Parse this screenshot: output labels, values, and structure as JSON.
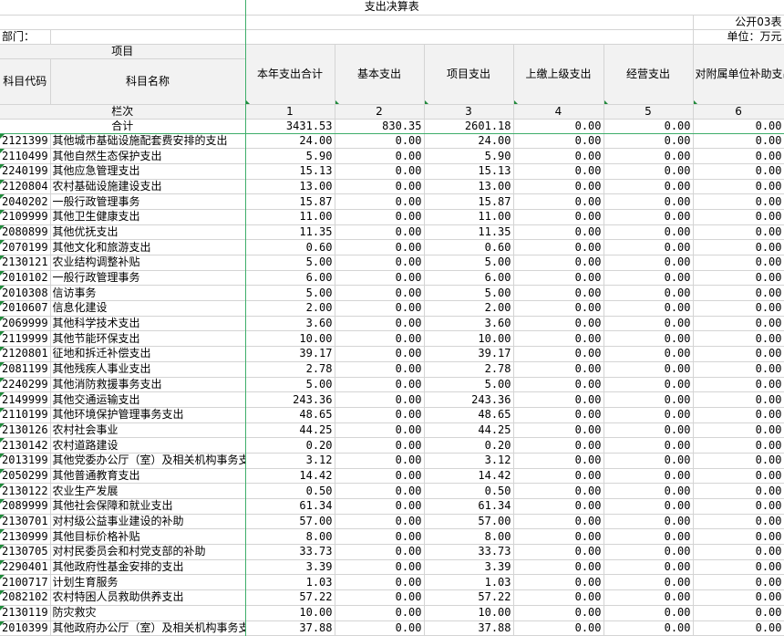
{
  "title": "支出决算表",
  "table_no": "公开03表",
  "department_label": "部门：",
  "unit_label": "单位：万元",
  "header": {
    "item_group": "项目",
    "code": "科目代码",
    "name": "科目名称",
    "cols": [
      "本年支出合计",
      "基本支出",
      "项目支出",
      "上缴上级支出",
      "经营支出",
      "对附属单位补助支出"
    ],
    "order_label": "栏次",
    "order_nums": [
      "1",
      "2",
      "3",
      "4",
      "5",
      "6"
    ]
  },
  "total": {
    "label": "合计",
    "values": [
      "3431.53",
      "830.35",
      "2601.18",
      "0.00",
      "0.00",
      "0.00"
    ]
  },
  "rows": [
    {
      "code": "2121399",
      "name": "其他城市基础设施配套费安排的支出",
      "v": [
        "24.00",
        "0.00",
        "24.00",
        "0.00",
        "0.00",
        "0.00"
      ]
    },
    {
      "code": "2110499",
      "name": "其他自然生态保护支出",
      "v": [
        "5.90",
        "0.00",
        "5.90",
        "0.00",
        "0.00",
        "0.00"
      ]
    },
    {
      "code": "2240199",
      "name": "其他应急管理支出",
      "v": [
        "15.13",
        "0.00",
        "15.13",
        "0.00",
        "0.00",
        "0.00"
      ]
    },
    {
      "code": "2120804",
      "name": "农村基础设施建设支出",
      "v": [
        "13.00",
        "0.00",
        "13.00",
        "0.00",
        "0.00",
        "0.00"
      ]
    },
    {
      "code": "2040202",
      "name": "一般行政管理事务",
      "v": [
        "15.87",
        "0.00",
        "15.87",
        "0.00",
        "0.00",
        "0.00"
      ]
    },
    {
      "code": "2109999",
      "name": "其他卫生健康支出",
      "v": [
        "11.00",
        "0.00",
        "11.00",
        "0.00",
        "0.00",
        "0.00"
      ]
    },
    {
      "code": "2080899",
      "name": "其他优抚支出",
      "v": [
        "11.35",
        "0.00",
        "11.35",
        "0.00",
        "0.00",
        "0.00"
      ]
    },
    {
      "code": "2070199",
      "name": "其他文化和旅游支出",
      "v": [
        "0.60",
        "0.00",
        "0.60",
        "0.00",
        "0.00",
        "0.00"
      ]
    },
    {
      "code": "2130121",
      "name": "农业结构调整补贴",
      "v": [
        "5.00",
        "0.00",
        "5.00",
        "0.00",
        "0.00",
        "0.00"
      ]
    },
    {
      "code": "2010102",
      "name": "一般行政管理事务",
      "v": [
        "6.00",
        "0.00",
        "6.00",
        "0.00",
        "0.00",
        "0.00"
      ]
    },
    {
      "code": "2010308",
      "name": "信访事务",
      "v": [
        "5.00",
        "0.00",
        "5.00",
        "0.00",
        "0.00",
        "0.00"
      ]
    },
    {
      "code": "2010607",
      "name": "信息化建设",
      "v": [
        "2.00",
        "0.00",
        "2.00",
        "0.00",
        "0.00",
        "0.00"
      ]
    },
    {
      "code": "2069999",
      "name": "其他科学技术支出",
      "v": [
        "3.60",
        "0.00",
        "3.60",
        "0.00",
        "0.00",
        "0.00"
      ]
    },
    {
      "code": "2119999",
      "name": "其他节能环保支出",
      "v": [
        "10.00",
        "0.00",
        "10.00",
        "0.00",
        "0.00",
        "0.00"
      ]
    },
    {
      "code": "2120801",
      "name": "征地和拆迁补偿支出",
      "v": [
        "39.17",
        "0.00",
        "39.17",
        "0.00",
        "0.00",
        "0.00"
      ]
    },
    {
      "code": "2081199",
      "name": "其他残疾人事业支出",
      "v": [
        "2.78",
        "0.00",
        "2.78",
        "0.00",
        "0.00",
        "0.00"
      ]
    },
    {
      "code": "2240299",
      "name": "其他消防救援事务支出",
      "v": [
        "5.00",
        "0.00",
        "5.00",
        "0.00",
        "0.00",
        "0.00"
      ]
    },
    {
      "code": "2149999",
      "name": "其他交通运输支出",
      "v": [
        "243.36",
        "0.00",
        "243.36",
        "0.00",
        "0.00",
        "0.00"
      ]
    },
    {
      "code": "2110199",
      "name": "其他环境保护管理事务支出",
      "v": [
        "48.65",
        "0.00",
        "48.65",
        "0.00",
        "0.00",
        "0.00"
      ]
    },
    {
      "code": "2130126",
      "name": "农村社会事业",
      "v": [
        "44.25",
        "0.00",
        "44.25",
        "0.00",
        "0.00",
        "0.00"
      ]
    },
    {
      "code": "2130142",
      "name": "农村道路建设",
      "v": [
        "0.20",
        "0.00",
        "0.20",
        "0.00",
        "0.00",
        "0.00"
      ]
    },
    {
      "code": "2013199",
      "name": "其他党委办公厅（室）及相关机构事务支",
      "v": [
        "3.12",
        "0.00",
        "3.12",
        "0.00",
        "0.00",
        "0.00"
      ]
    },
    {
      "code": "2050299",
      "name": "其他普通教育支出",
      "v": [
        "14.42",
        "0.00",
        "14.42",
        "0.00",
        "0.00",
        "0.00"
      ]
    },
    {
      "code": "2130122",
      "name": "农业生产发展",
      "v": [
        "0.50",
        "0.00",
        "0.50",
        "0.00",
        "0.00",
        "0.00"
      ]
    },
    {
      "code": "2089999",
      "name": "其他社会保障和就业支出",
      "v": [
        "61.34",
        "0.00",
        "61.34",
        "0.00",
        "0.00",
        "0.00"
      ]
    },
    {
      "code": "2130701",
      "name": "对村级公益事业建设的补助",
      "v": [
        "57.00",
        "0.00",
        "57.00",
        "0.00",
        "0.00",
        "0.00"
      ]
    },
    {
      "code": "2130999",
      "name": "其他目标价格补贴",
      "v": [
        "8.00",
        "0.00",
        "8.00",
        "0.00",
        "0.00",
        "0.00"
      ]
    },
    {
      "code": "2130705",
      "name": "对村民委员会和村党支部的补助",
      "v": [
        "33.73",
        "0.00",
        "33.73",
        "0.00",
        "0.00",
        "0.00"
      ]
    },
    {
      "code": "2290401",
      "name": "其他政府性基金安排的支出",
      "v": [
        "3.39",
        "0.00",
        "3.39",
        "0.00",
        "0.00",
        "0.00"
      ]
    },
    {
      "code": "2100717",
      "name": "计划生育服务",
      "v": [
        "1.03",
        "0.00",
        "1.03",
        "0.00",
        "0.00",
        "0.00"
      ]
    },
    {
      "code": "2082102",
      "name": "农村特困人员救助供养支出",
      "v": [
        "57.22",
        "0.00",
        "57.22",
        "0.00",
        "0.00",
        "0.00"
      ]
    },
    {
      "code": "2130119",
      "name": "防灾救灾",
      "v": [
        "10.00",
        "0.00",
        "10.00",
        "0.00",
        "0.00",
        "0.00"
      ]
    },
    {
      "code": "2010399",
      "name": "其他政府办公厅（室）及相关机构事务支",
      "v": [
        "37.88",
        "0.00",
        "37.88",
        "0.00",
        "0.00",
        "0.00"
      ]
    }
  ]
}
